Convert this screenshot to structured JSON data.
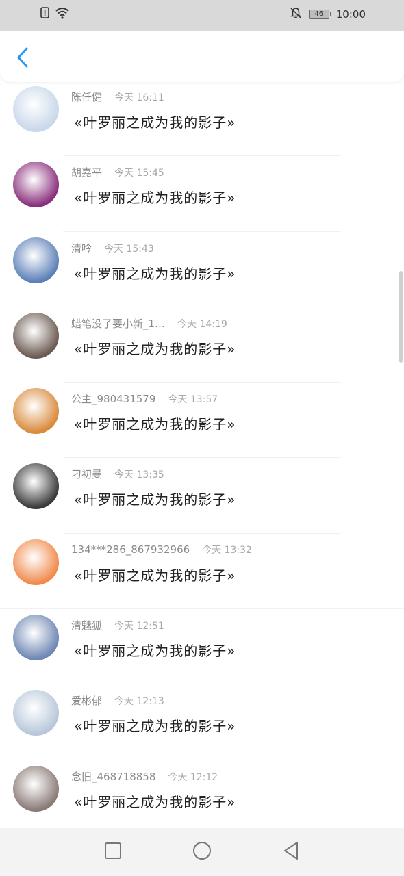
{
  "status_bar": {
    "time": "10:00",
    "battery": "46",
    "icons": [
      "alert-icon",
      "wifi-icon",
      "mute-bell-icon",
      "battery-icon"
    ]
  },
  "header": {
    "back_icon": "chevron-left-icon",
    "accent_color": "#2196f3"
  },
  "items": [
    {
      "name": "陈任健",
      "time": "今天 16:11",
      "title": "«叶罗丽之成为我的影子»",
      "avatar_color": "#c8d7ea"
    },
    {
      "name": "胡嘉平",
      "time": "今天 15:45",
      "title": "«叶罗丽之成为我的影子»",
      "avatar_color": "#8a2f7c"
    },
    {
      "name": "清吟",
      "time": "今天 15:43",
      "title": "«叶罗丽之成为我的影子»",
      "avatar_color": "#5c7fb8"
    },
    {
      "name": "蜡笔没了要小新_1…",
      "time": "今天 14:19",
      "title": "«叶罗丽之成为我的影子»",
      "avatar_color": "#6b5a52"
    },
    {
      "name": "公主_980431579",
      "time": "今天 13:57",
      "title": "«叶罗丽之成为我的影子»",
      "avatar_color": "#d98a3c"
    },
    {
      "name": "刁初曼",
      "time": "今天 13:35",
      "title": "«叶罗丽之成为我的影子»",
      "avatar_color": "#3a3a3a"
    },
    {
      "name": "134***286_867932966",
      "time": "今天 13:32",
      "title": "«叶罗丽之成为我的影子»",
      "avatar_color": "#f08a4b"
    },
    {
      "name": "清魅狐",
      "time": "今天 12:51",
      "title": "«叶罗丽之成为我的影子»",
      "avatar_color": "#6f87b3"
    },
    {
      "name": "爱彬郁",
      "time": "今天 12:13",
      "title": "«叶罗丽之成为我的影子»",
      "avatar_color": "#b7c7d9"
    },
    {
      "name": "念旧_468718858",
      "time": "今天 12:12",
      "title": "«叶罗丽之成为我的影子»",
      "avatar_color": "#8a7a77"
    }
  ],
  "nav": {
    "icons": [
      "square-recent-icon",
      "circle-home-icon",
      "triangle-back-icon"
    ]
  }
}
